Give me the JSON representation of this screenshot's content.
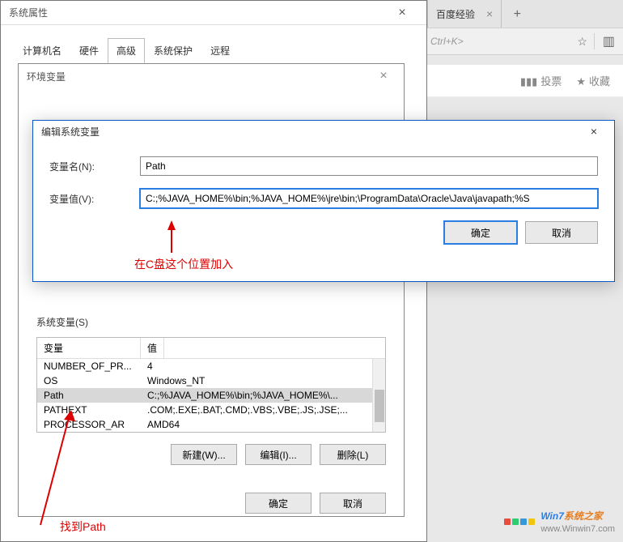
{
  "browser": {
    "tab_label": "百度经验",
    "addr_hint": "Ctrl+K>",
    "action_vote": "投票",
    "action_fav": "收藏"
  },
  "sys_prop": {
    "title": "系统属性",
    "tabs": {
      "computer_name": "计算机名",
      "hardware": "硬件",
      "advanced": "高级",
      "system_protection": "系统保护",
      "remote": "远程"
    }
  },
  "env_dialog": {
    "title": "环境变量",
    "sys_vars_label": "系统变量(S)",
    "columns": {
      "var": "变量",
      "value": "值"
    },
    "rows": [
      {
        "var": "NUMBER_OF_PR...",
        "value": "4"
      },
      {
        "var": "OS",
        "value": "Windows_NT"
      },
      {
        "var": "Path",
        "value": "C:;%JAVA_HOME%\\bin;%JAVA_HOME%\\..."
      },
      {
        "var": "PATHEXT",
        "value": ".COM;.EXE;.BAT;.CMD;.VBS;.VBE;.JS;.JSE;..."
      },
      {
        "var": "PROCESSOR_AR",
        "value": "AMD64"
      }
    ],
    "buttons": {
      "new": "新建(W)...",
      "edit": "编辑(I)...",
      "delete": "删除(L)"
    },
    "footer": {
      "ok": "确定",
      "cancel": "取消"
    }
  },
  "edit_dialog": {
    "title": "编辑系统变量",
    "name_label": "变量名(N):",
    "name_value": "Path",
    "value_label": "变量值(V):",
    "value_value": "C:;%JAVA_HOME%\\bin;%JAVA_HOME%\\jre\\bin;\\ProgramData\\Oracle\\Java\\javapath;%S",
    "ok": "确定",
    "cancel": "取消"
  },
  "annotations": {
    "insert_c": "在C盘这个位置加入",
    "find_path": "找到Path"
  },
  "watermark": {
    "brand_prefix": "Win7",
    "brand_suffix": "系统之家",
    "url": "www.Winwin7.com"
  }
}
